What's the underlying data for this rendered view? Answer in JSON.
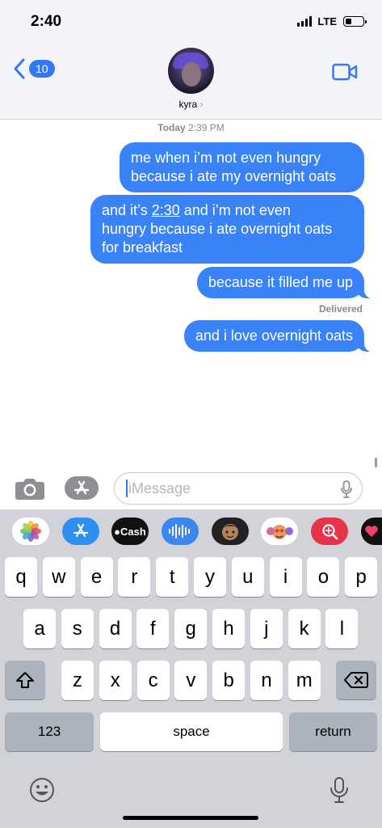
{
  "status_bar": {
    "time": "2:40",
    "network": "LTE",
    "battery_level": 0.35
  },
  "header": {
    "back_count": "10",
    "contact_name": "kyra",
    "name_chevron": "›"
  },
  "conversation": {
    "timestamp_day": "Today",
    "timestamp_time": "2:39 PM",
    "messages": [
      {
        "line1": "me when i’m not even hungry",
        "line2": "because i ate my overnight oats"
      },
      {
        "line1_pre": "and it’s ",
        "line1_time": "2:30",
        "line1_post": " and i’m not even",
        "line2": "hungry because i ate overnight oats",
        "line3": "for breakfast"
      },
      {
        "text": "because it filled me up"
      },
      {
        "text": "and i love overnight oats"
      }
    ],
    "delivered_label": "Delivered"
  },
  "input_bar": {
    "placeholder": "iMessage"
  },
  "app_drawer": {
    "apps": [
      {
        "name": "Photos",
        "icon": "photos-icon"
      },
      {
        "name": "App Store",
        "icon": "app-store-icon"
      },
      {
        "name": "Cash",
        "label": "Cash",
        "icon": "apple-cash-icon"
      },
      {
        "name": "Audio",
        "icon": "audio-message-icon"
      },
      {
        "name": "Memoji",
        "icon": "memoji-icon"
      },
      {
        "name": "Memoji Stickers",
        "icon": "memoji-stickers-icon"
      },
      {
        "name": "Search",
        "icon": "web-search-icon"
      },
      {
        "name": "Digital Touch",
        "icon": "digital-touch-icon"
      }
    ]
  },
  "keyboard": {
    "row1": [
      "q",
      "w",
      "e",
      "r",
      "t",
      "y",
      "u",
      "i",
      "o",
      "p"
    ],
    "row2": [
      "a",
      "s",
      "d",
      "f",
      "g",
      "h",
      "j",
      "k",
      "l"
    ],
    "row3": [
      "z",
      "x",
      "c",
      "v",
      "b",
      "n",
      "m"
    ],
    "numbers_label": "123",
    "space_label": "space",
    "return_label": "return"
  },
  "colors": {
    "bubble_blue": "#3a82f7",
    "accent": "#3478f6",
    "keyboard_bg": "#d1d3d9"
  }
}
